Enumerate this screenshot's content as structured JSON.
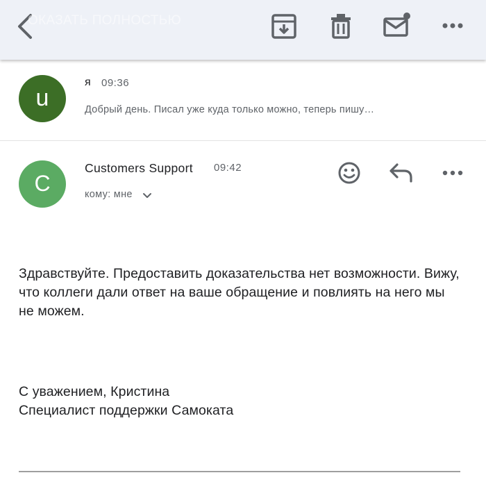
{
  "toolbar": {
    "ghost_text": "ОКАЗАТЬ ПОЛНОСТЬЮ",
    "icons": [
      "back-chevron-icon",
      "archive-icon",
      "trash-icon",
      "mail-unread-icon",
      "more-horizontal-icon"
    ]
  },
  "thread": [
    {
      "avatar_letter": "u",
      "avatar_color": "#3c6e26",
      "sender": "я",
      "time": "09:36",
      "snippet": "Добрый день. Писал уже куда только можно, теперь пишу…"
    },
    {
      "avatar_letter": "C",
      "avatar_color": "#5bab63",
      "sender": "Customers Support",
      "time": "09:42",
      "to_label": "кому: мне",
      "body": "Здравствуйте. Предоставить доказательства нет возможности. Вижу, что коллеги дали ответ на ваше обращение и повлиять на него мы не можем.",
      "signature_line1": "С уважением, Кристина",
      "signature_line2": "Специалист поддержки Самоката",
      "icons": [
        "emoji-icon",
        "reply-icon",
        "more-horizontal-icon"
      ]
    }
  ],
  "colors": {
    "toolbar_bg": "#eef1f7",
    "icon_gray": "#5f6368"
  }
}
